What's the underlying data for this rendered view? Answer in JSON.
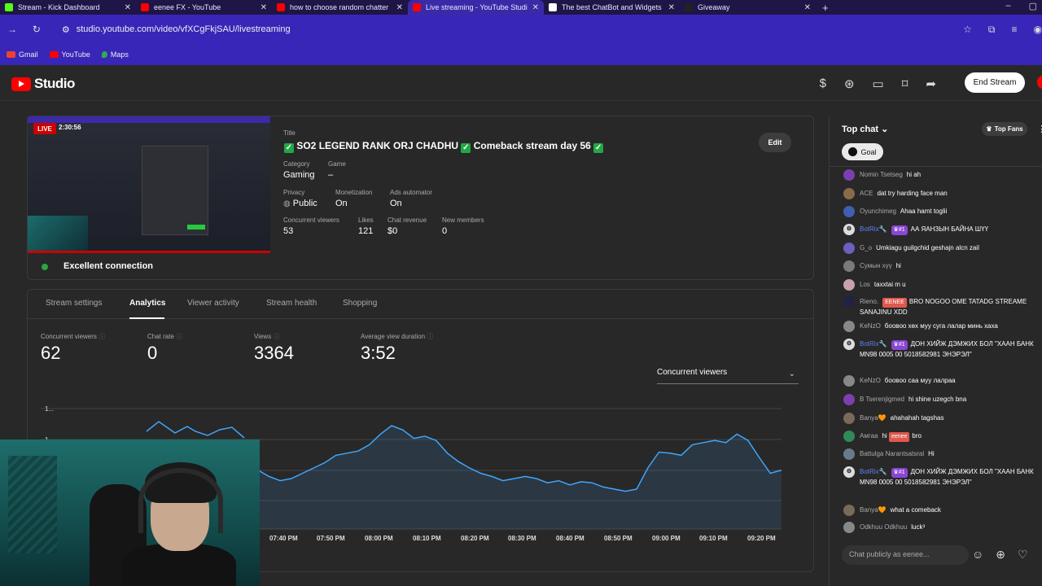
{
  "browser": {
    "tabs": [
      {
        "title": "Stream - Kick Dashboard",
        "color": "#53fc18"
      },
      {
        "title": "eenee FX - YouTube",
        "color": "#ff0000"
      },
      {
        "title": "how to choose random chatter",
        "color": "#ff0000"
      },
      {
        "title": "Live streaming - YouTube Studio",
        "color": "#ff0000"
      },
      {
        "title": "The best ChatBot and Widgets",
        "color": "#ffffff"
      },
      {
        "title": "Giveaway",
        "color": "#222222"
      }
    ],
    "url": "studio.youtube.com/video/vfXCgFkjSAU/livestreaming",
    "bookmarks": [
      "Gmail",
      "YouTube",
      "Maps"
    ]
  },
  "header": {
    "logo_text": "Studio",
    "end_stream": "End Stream"
  },
  "stream": {
    "live_badge": "LIVE",
    "elapsed": "2:30:56",
    "title_label": "Title",
    "title": "SO2 LEGEND RANK ORJ CHADHU",
    "title_mid": "Comeback stream day 56",
    "category_label": "Category",
    "category": "Gaming",
    "game_label": "Game",
    "game": "–",
    "privacy_label": "Privacy",
    "privacy": "Public",
    "monetization_label": "Monetization",
    "monetization": "On",
    "ads_label": "Ads automator",
    "ads": "On",
    "cv_label": "Concurrent viewers",
    "cv": "53",
    "likes_label": "Likes",
    "likes": "121",
    "revenue_label": "Chat revenue",
    "revenue": "$0",
    "members_label": "New members",
    "members": "0",
    "edit": "Edit",
    "connection": "Excellent connection"
  },
  "analytics": {
    "tabs": [
      "Stream settings",
      "Analytics",
      "Viewer activity",
      "Stream health",
      "Shopping"
    ],
    "metrics": [
      {
        "label": "Concurrent viewers",
        "value": "62"
      },
      {
        "label": "Chat rate",
        "value": "0"
      },
      {
        "label": "Views",
        "value": "3364"
      },
      {
        "label": "Average view duration",
        "value": "3:52"
      }
    ],
    "dropdown": "Concurrent viewers"
  },
  "chart_data": {
    "type": "line",
    "title": "",
    "xlabel": "",
    "ylabel": "",
    "y_ticks": [
      "1...",
      "1..."
    ],
    "x_ticks": [
      "07:40 PM",
      "07:50 PM",
      "08:00 PM",
      "08:10 PM",
      "08:20 PM",
      "08:30 PM",
      "08:40 PM",
      "08:50 PM",
      "09:00 PM",
      "09:10 PM",
      "09:20 PM"
    ],
    "ylim": [
      0,
      1
    ],
    "series": [
      {
        "name": "",
        "values": [
          0.6,
          0.62,
          0.6,
          0.58,
          0.55,
          0.5,
          0.46,
          0.42,
          0.4,
          0.44,
          0.48,
          0.42,
          0.38,
          0.4,
          0.45,
          0.5,
          0.55,
          0.62,
          0.64,
          0.66,
          0.72,
          0.82,
          0.9,
          0.86,
          0.78,
          0.8,
          0.76,
          0.64,
          0.56,
          0.5,
          0.45,
          0.42,
          0.38,
          0.4,
          0.42,
          0.4,
          0.36,
          0.38,
          0.34,
          0.37,
          0.36,
          0.32,
          0.3,
          0.28,
          0.3,
          0.5,
          0.65,
          0.64,
          0.62,
          0.72,
          0.74,
          0.76,
          0.74,
          0.82,
          0.76,
          0.6,
          0.45,
          0.48
        ]
      }
    ],
    "color": "#3ea6ff"
  },
  "chat": {
    "header": "Top chat",
    "top_fans": "Top Fans",
    "goal": "Goal",
    "messages": [
      {
        "author": "Nomin Tsetseg",
        "text": "hi ah",
        "avatar": "N",
        "avcolor": "#7b3fb0"
      },
      {
        "author": "ACE",
        "text": "dat try harding face man",
        "avatar": "",
        "avcolor": "#8a6a4a"
      },
      {
        "author": "Oyunchimeg",
        "text": "Ahaa hamt toglii",
        "avatar": "O",
        "avcolor": "#3f5fb0"
      },
      {
        "author": "BotRix🔧",
        "rank": "#1",
        "text": "АА ЯАНЗЫН БАЙНА ШҮҮ",
        "avatar": "",
        "avcolor": "#dddddd",
        "mod": true
      },
      {
        "author": "G_o",
        "text": "Umkiagu guilgchid geshajn alcn zail",
        "avatar": "G",
        "avcolor": "#6b5fc0"
      },
      {
        "author": "Сумын хүү",
        "text": "hi",
        "avatar": "",
        "avcolor": "#7a7a7a"
      },
      {
        "author": "Los",
        "text": "taxxtai m u",
        "avatar": "",
        "avcolor": "#c9a0b0"
      },
      {
        "author": "Rieno.",
        "badge": "EENEE",
        "text": "BRO NOGOO OME TATADG STREAME SANAJINU XDD",
        "avatar": "",
        "avcolor": "#222244"
      },
      {
        "author": "KeNzO",
        "text": "боовоо хөх муу суга лалар минь хаха",
        "avatar": "",
        "avcolor": "#888888"
      },
      {
        "author": "BotRix🔧",
        "rank": "#1",
        "text": "ДОН ХИЙЖ ДЭМЖИХ БОЛ \"ХААН БАНК MN98 0005 00 5018582981 ЭНЭРЭЛ\"",
        "avatar": "",
        "avcolor": "#dddddd",
        "mod": true
      },
      {
        "author": "KeNzO",
        "text": "боовоо саа муу лалраа",
        "avatar": "",
        "avcolor": "#888888"
      },
      {
        "author": "B Tserenjigmed",
        "text": "hi shine uzegch bna",
        "avatar": "B",
        "avcolor": "#7b3fb0"
      },
      {
        "author": "Banya🧡",
        "text": "ahahahah tagshas",
        "avatar": "",
        "avcolor": "#7a6a5a"
      },
      {
        "author": "Амгаа",
        "text": "hi",
        "badge2": "eenee",
        "text2": "bro",
        "avatar": "A",
        "avcolor": "#2e8b57"
      },
      {
        "author": "Battulga Narantsatsral",
        "text": "Hi",
        "avatar": "B",
        "avcolor": "#6a7a8a"
      },
      {
        "author": "BotRix🔧",
        "rank": "#1",
        "text": "ДОН ХИЙЖ ДЭМЖИХ БОЛ \"ХААН БАНК MN98 0005 00 5018582981 ЭНЭРЭЛ\"",
        "avatar": "",
        "avcolor": "#dddddd",
        "mod": true
      },
      {
        "author": "Banya🧡",
        "text": "what a comeback",
        "avatar": "",
        "avcolor": "#7a6a5a"
      },
      {
        "author": "Odkhuu Odkhuu",
        "text": "luck³",
        "avatar": "",
        "avcolor": "#888888"
      }
    ],
    "input_placeholder": "Chat publicly as eenee..."
  }
}
